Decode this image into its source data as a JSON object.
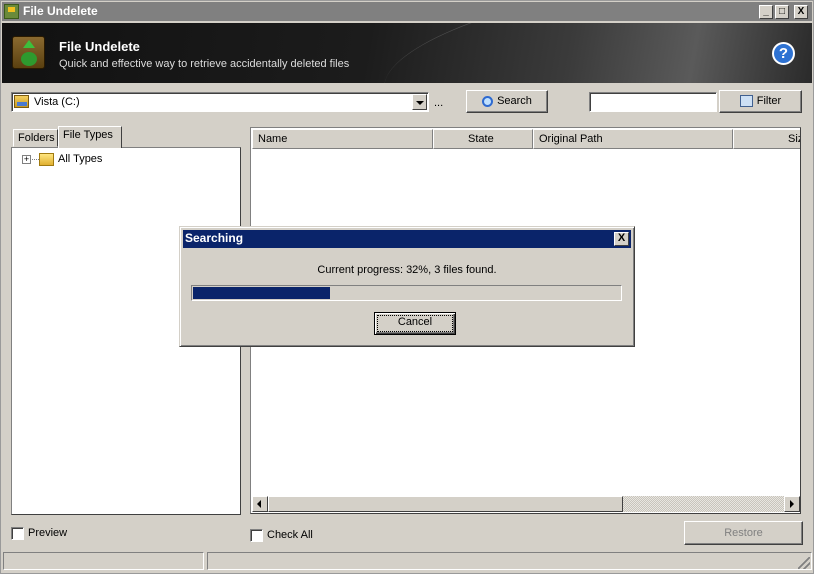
{
  "window": {
    "title": "File Undelete",
    "controls": [
      "_",
      "□",
      "X"
    ]
  },
  "header": {
    "title": "File Undelete",
    "subtitle": "Quick and effective way to retrieve accidentally deleted files",
    "help_glyph": "?"
  },
  "toolbar": {
    "drive_value": "Vista (C:)",
    "browse_label": "...",
    "search_label": "Search",
    "filter_input_value": "",
    "filter_label": "Filter"
  },
  "tabs": [
    {
      "label": "Folders",
      "selected": false
    },
    {
      "label": "File Types",
      "selected": true
    }
  ],
  "tree": {
    "items": [
      {
        "label": "All Types",
        "expander": "+"
      }
    ]
  },
  "file_list": {
    "columns": [
      "Name",
      "State",
      "Original Path",
      "Siz"
    ]
  },
  "bottom": {
    "preview_label": "Preview",
    "check_all_label": "Check All",
    "restore_label": "Restore"
  },
  "dialog": {
    "title": "Searching",
    "close_glyph": "X",
    "message": "Current progress: 32%, 3 files found.",
    "progress": 0.32,
    "cancel_label": "Cancel"
  },
  "colors": {
    "titlebar_inactive": "#808080",
    "dialog_title": "#0a246a",
    "progress_fill": "#0a246a",
    "chrome": "#d4d0c8"
  }
}
